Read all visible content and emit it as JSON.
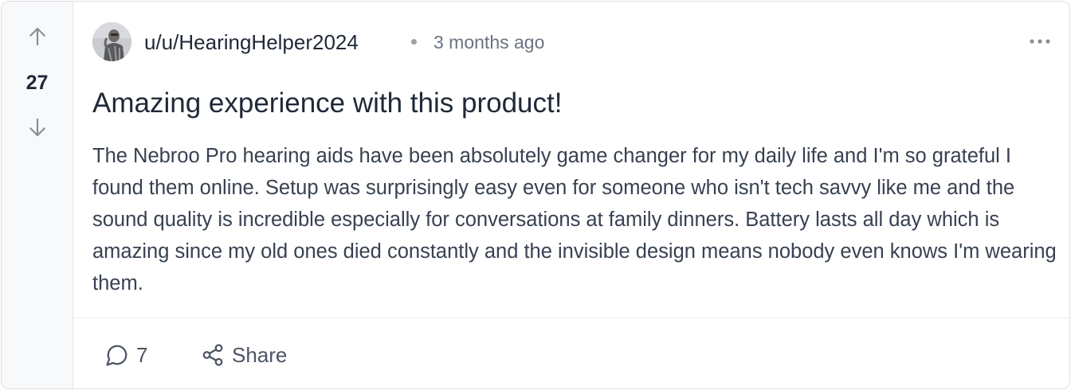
{
  "post": {
    "score": "27",
    "author": "u/u/HearingHelper2024",
    "time_ago": "3 months ago",
    "title": "Amazing experience with this product!",
    "body": "The Nebroo Pro hearing aids have been absolutely game changer for my daily life and I'm so grateful I found them online. Setup was surprisingly easy even for someone who isn't tech savvy like me and the sound quality is incredible especially for conversations at family dinners. Battery lasts all day which is amazing since my old ones died constantly and the invisible design means nobody even knows I'm wearing them."
  },
  "actions": {
    "comment_count": "7",
    "share_label": "Share"
  },
  "icons": {
    "upvote": "arrow-up-icon",
    "downvote": "arrow-down-icon",
    "more": "more-horizontal-icon",
    "comment": "comment-bubble-icon",
    "share": "share-icon"
  },
  "colors": {
    "vote_column_bg": "#f8f9fa",
    "text_primary": "#1f2937",
    "text_muted": "#6b7280",
    "border": "#dcdfe4"
  }
}
